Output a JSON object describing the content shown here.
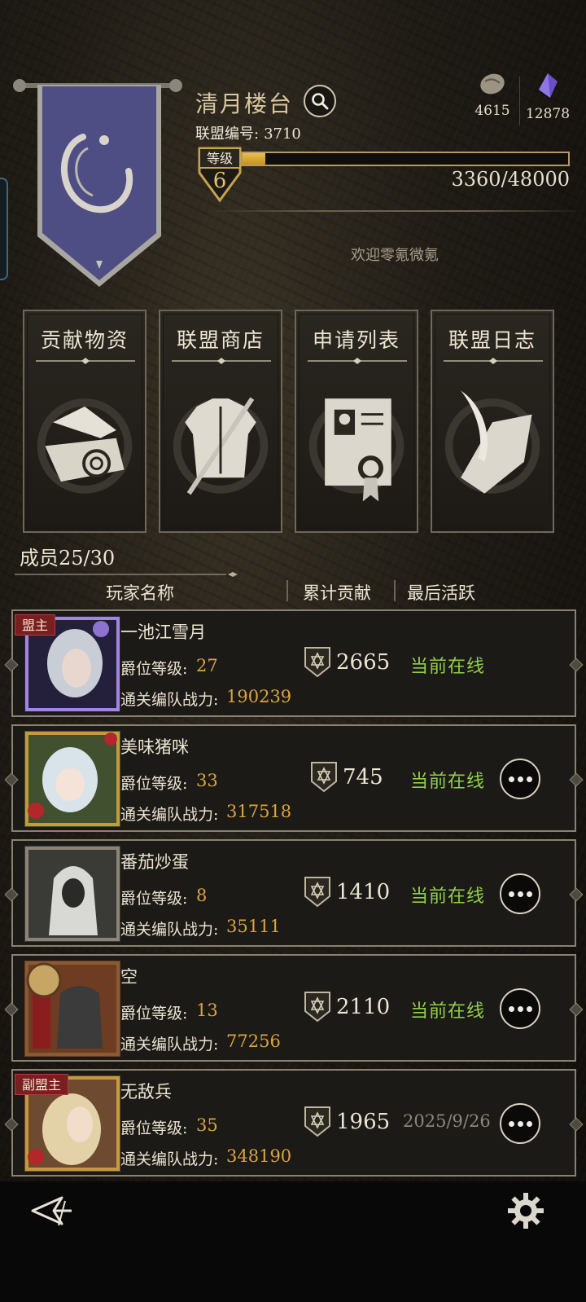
{
  "header": {
    "alliance_name": "清月楼台",
    "alliance_id_label": "联盟编号:",
    "alliance_id": "3710",
    "level_label": "等级",
    "level": "6",
    "xp_text": "3360/48000",
    "xp_progress": 0.07,
    "welcome": "欢迎零氪微氪",
    "currencies": [
      {
        "icon": "stone-icon",
        "value": "4615"
      },
      {
        "icon": "crystal-icon",
        "value": "12878"
      }
    ]
  },
  "functions": [
    {
      "label": "贡献物资",
      "icon": "supplies-icon"
    },
    {
      "label": "联盟商店",
      "icon": "armor-shop-icon"
    },
    {
      "label": "申请列表",
      "icon": "application-scroll-icon"
    },
    {
      "label": "联盟日志",
      "icon": "quill-log-icon"
    }
  ],
  "members": {
    "count_label": "成员25/30",
    "columns": {
      "name": "玩家名称",
      "contribution": "累计贡献",
      "last_active": "最后活跃"
    },
    "level_label": "爵位等级:",
    "power_label": "通关编队战力:",
    "rows": [
      {
        "name": "一池江雪月",
        "role": "盟主",
        "level": "27",
        "power": "190239",
        "contribution": "2665",
        "status": "当前在线",
        "online": true,
        "has_more": false
      },
      {
        "name": "美味猪咪",
        "role": "",
        "level": "33",
        "power": "317518",
        "contribution": "745",
        "status": "当前在线",
        "online": true,
        "has_more": true
      },
      {
        "name": "番茄炒蛋",
        "role": "",
        "level": "8",
        "power": "35111",
        "contribution": "1410",
        "status": "当前在线",
        "online": true,
        "has_more": true
      },
      {
        "name": "空",
        "role": "",
        "level": "13",
        "power": "77256",
        "contribution": "2110",
        "status": "当前在线",
        "online": true,
        "has_more": true
      },
      {
        "name": "无敌兵",
        "role": "副盟主",
        "level": "35",
        "power": "348190",
        "contribution": "1965",
        "status": "2025/9/26",
        "online": false,
        "has_more": true
      }
    ]
  },
  "colors": {
    "online": "#8fd04a",
    "gold": "#d9a441",
    "banner": "#4c4c80"
  }
}
